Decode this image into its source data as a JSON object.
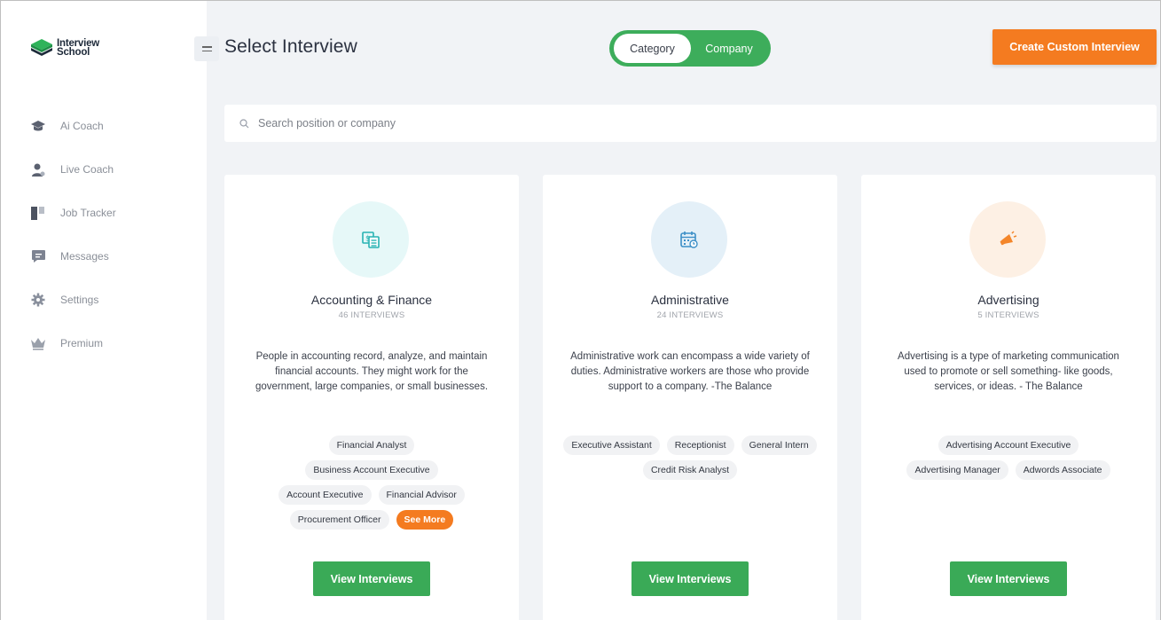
{
  "brand": {
    "line1": "Interview",
    "line2": "School"
  },
  "sidebar": {
    "items": [
      {
        "label": "Ai Coach",
        "icon": "graduation-cap-icon"
      },
      {
        "label": "Live Coach",
        "icon": "person-icon"
      },
      {
        "label": "Job Tracker",
        "icon": "kanban-icon"
      },
      {
        "label": "Messages",
        "icon": "chat-icon"
      },
      {
        "label": "Settings",
        "icon": "gear-icon"
      },
      {
        "label": "Premium",
        "icon": "crown-icon"
      }
    ]
  },
  "header": {
    "title": "Select Interview",
    "toggle": {
      "options": [
        "Category",
        "Company"
      ],
      "selected": "Category"
    },
    "create_label": "Create Custom Interview"
  },
  "search": {
    "placeholder": "Search position or company",
    "value": ""
  },
  "colors": {
    "green": "#3aaa57",
    "orange": "#f47b20"
  },
  "cards": [
    {
      "title": "Accounting & Finance",
      "count": "46 INTERVIEWS",
      "description": "People in accounting record, analyze, and maintain financial accounts. They might work for the government, large companies, or small businesses.",
      "icon": "finance-icon",
      "tags": [
        "Financial Analyst",
        "Business Account Executive",
        "Account Executive",
        "Financial Advisor",
        "Procurement Officer"
      ],
      "see_more": "See More",
      "button": "View Interviews"
    },
    {
      "title": "Administrative",
      "count": "24 INTERVIEWS",
      "description": "Administrative work can encompass a wide variety of duties. Administrative workers are those who provide support to a company. -The Balance",
      "icon": "calendar-icon",
      "tags": [
        "Executive Assistant",
        "Receptionist",
        "General Intern",
        "Credit Risk Analyst"
      ],
      "button": "View Interviews"
    },
    {
      "title": "Advertising",
      "count": "5 INTERVIEWS",
      "description": "Advertising is a type of marketing communication used to promote or sell something- like goods, services, or ideas. - The Balance",
      "icon": "megaphone-icon",
      "tags": [
        "Advertising Account Executive",
        "Advertising Manager",
        "Adwords Associate"
      ],
      "button": "View Interviews"
    }
  ]
}
